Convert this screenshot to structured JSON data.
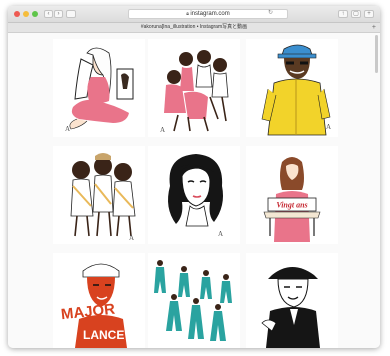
{
  "browser": {
    "address_bar": "instagram.com",
    "tab_title": "#akoruna[Ina_illustration • Instagram写真と動画"
  },
  "posts": [
    {
      "name": "post-woman-pink-dress"
    },
    {
      "name": "post-three-women-pink"
    },
    {
      "name": "post-man-yellow-coat"
    },
    {
      "name": "post-three-singers"
    },
    {
      "name": "post-woman-bob-portrait"
    },
    {
      "name": "post-woman-sign"
    },
    {
      "name": "post-major-lance"
    },
    {
      "name": "post-dancers-teal"
    },
    {
      "name": "post-man-with-hat"
    }
  ],
  "artwork_text": {
    "sign_text": "Vingt ans",
    "poster_line1": "MAJOR",
    "poster_line2": "LANCE",
    "signature": "A"
  },
  "colors": {
    "pink": "#e9748a",
    "yellow": "#f2d32a",
    "teal": "#2aa3a0",
    "red": "#d8421f",
    "blue_hat": "#3b8fcf"
  }
}
